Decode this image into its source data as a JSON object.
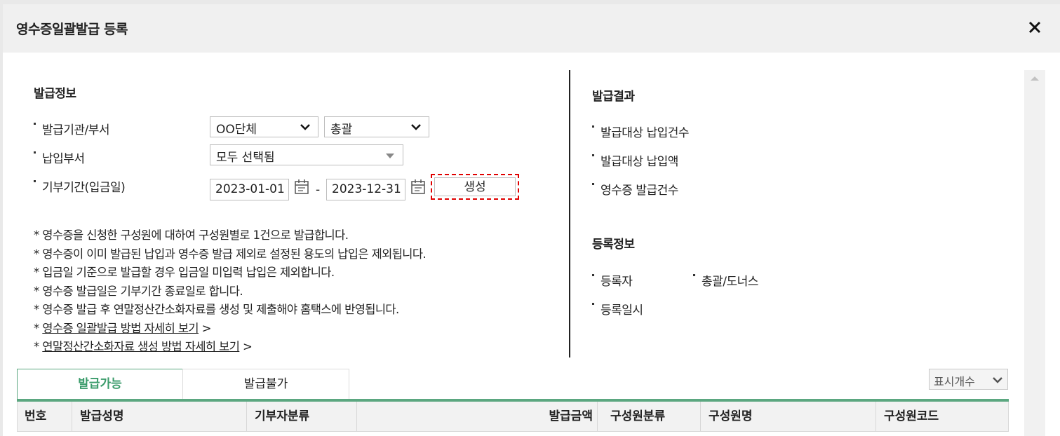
{
  "dialog": {
    "title": "영수증일괄발급 등록"
  },
  "issue_info": {
    "title": "발급정보",
    "org_label": "발급기관/부서",
    "org_value": "OO단체",
    "dept_value": "총괄",
    "pay_dept_label": "납입부서",
    "pay_dept_value": "모두 선택됨",
    "period_label": "기부기간(입금일)",
    "date_from": "2023-01-01",
    "date_to": "2023-12-31",
    "date_sep": "-",
    "generate_label": "생성"
  },
  "notes": [
    "* 영수증을 신청한 구성원에 대하여 구성원별로 1건으로 발급합니다.",
    "* 영수증이 이미 발급된 납입과 영수증 발급 제외로 설정된 용도의 납입은 제외됩니다.",
    "* 입금일 기준으로 발급할 경우 입금일 미입력 납입은 제외합니다.",
    "* 영수증 발급일은 기부기간 종료일로 합니다.",
    "* 영수증 발급 후 연말정산간소화자료를 생성 및 제출해야 홈택스에 반영됩니다."
  ],
  "links": [
    {
      "prefix": "* ",
      "text": "영수증 일괄발급 방법 자세히 보기",
      "suffix": " >"
    },
    {
      "prefix": "* ",
      "text": "연말정산간소화자료 생성 방법 자세히 보기",
      "suffix": " >"
    }
  ],
  "result": {
    "title": "발급결과",
    "target_count_label": "발급대상 납입건수",
    "target_amount_label": "발급대상 납입액",
    "receipt_count_label": "영수증 발급건수"
  },
  "registration": {
    "title": "등록정보",
    "registrant_label": "등록자",
    "registrant_value": "총괄/도너스",
    "datetime_label": "등록일시"
  },
  "tabs": {
    "available": "발급가능",
    "unavailable": "발급불가"
  },
  "display_count_label": "표시개수",
  "table": {
    "columns": [
      "번호",
      "발급성명",
      "기부자분류",
      "발급금액",
      "구성원분류",
      "구성원명",
      "구성원코드"
    ]
  },
  "colors": {
    "accent": "#5ba780",
    "accent_text": "#3a9b6a",
    "highlight": "#e00000"
  },
  "icons": {
    "close": "close-icon",
    "calendar": "calendar-icon",
    "chevron": "chevron-down-icon"
  }
}
